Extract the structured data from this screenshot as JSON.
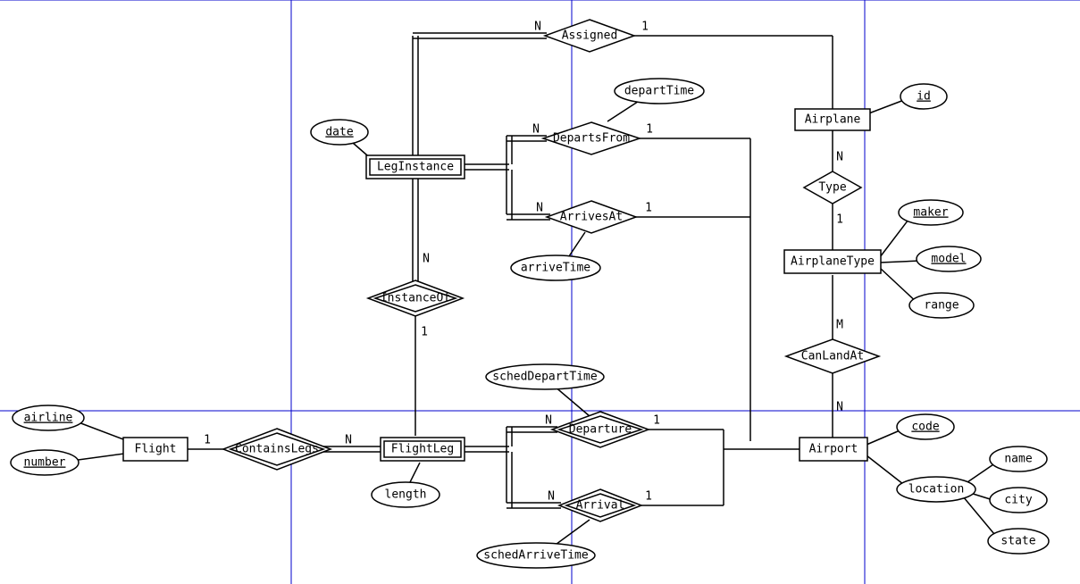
{
  "entities": {
    "Flight": "Flight",
    "FlightLeg": "FlightLeg",
    "LegInstance": "LegInstance",
    "Airplane": "Airplane",
    "AirplaneType": "AirplaneType",
    "Airport": "Airport"
  },
  "relationships": {
    "ContainsLegs": "ContainsLegs",
    "InstanceOf": "InstanceOf",
    "Assigned": "Assigned",
    "DepartsFrom": "DepartsFrom",
    "ArrivesAt": "ArrivesAt",
    "Type": "Type",
    "CanLandAt": "CanLandAt",
    "Departure": "Departure",
    "Arrival": "Arrival"
  },
  "attributes": {
    "airline": "airline",
    "number": "number",
    "length": "length",
    "date": "date",
    "departTime": "departTime",
    "arriveTime": "arriveTime",
    "schedDepartTime": "schedDepartTime",
    "schedArriveTime": "schedArriveTime",
    "id": "id",
    "maker": "maker",
    "model": "model",
    "range": "range",
    "code": "code",
    "name": "name",
    "city": "city",
    "state": "state",
    "location": "location"
  },
  "cardinalities": {
    "one": "1",
    "N": "N",
    "M": "M"
  }
}
